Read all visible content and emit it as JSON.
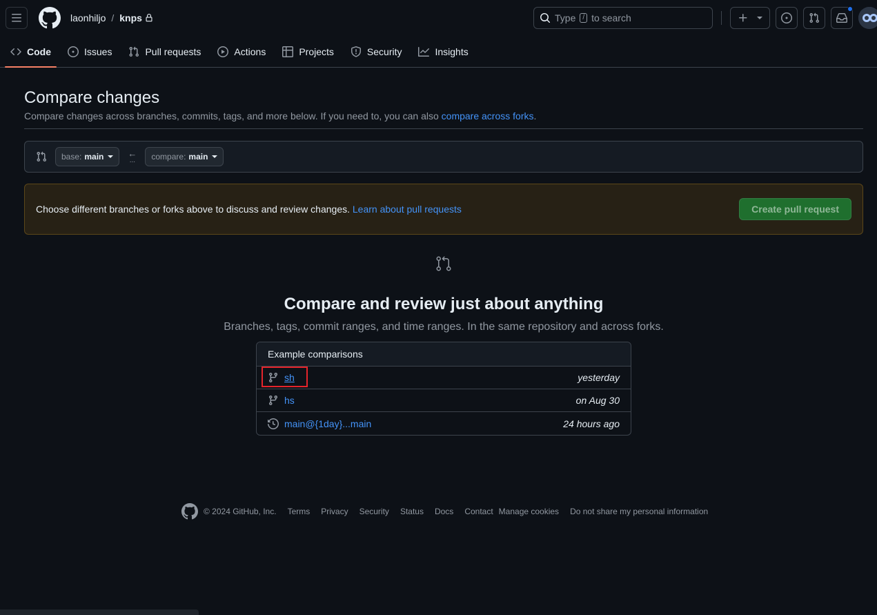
{
  "header": {
    "owner": "laonhiljo",
    "separator": "/",
    "repo": "knps",
    "search_type": "Type",
    "search_key": "/",
    "search_rest": "to search"
  },
  "nav": [
    {
      "label": "Code",
      "icon": "code-icon"
    },
    {
      "label": "Issues",
      "icon": "issue-icon"
    },
    {
      "label": "Pull requests",
      "icon": "pull-request-icon"
    },
    {
      "label": "Actions",
      "icon": "play-icon"
    },
    {
      "label": "Projects",
      "icon": "table-icon"
    },
    {
      "label": "Security",
      "icon": "shield-icon"
    },
    {
      "label": "Insights",
      "icon": "graph-icon"
    }
  ],
  "compare": {
    "title": "Compare changes",
    "subtitle": "Compare changes across branches, commits, tags, and more below. If you need to, you can also",
    "subtitle_link": "compare across forks",
    "subtitle_end": ".",
    "base_prefix": "base:",
    "base_value": "main",
    "compare_prefix": "compare:",
    "compare_value": "main",
    "arrow": "←",
    "dots": "..."
  },
  "flash": {
    "text": "Choose different branches or forks above to discuss and review changes.",
    "link": "Learn about pull requests",
    "button": "Create pull request"
  },
  "blankslate": {
    "title": "Compare and review just about anything",
    "subtitle": "Branches, tags, commit ranges, and time ranges. In the same repository and across forks."
  },
  "examples": {
    "header": "Example comparisons",
    "rows": [
      {
        "name": "sh",
        "time": "yesterday",
        "icon": "git-branch-icon"
      },
      {
        "name": "hs",
        "time": "on Aug 30",
        "icon": "git-branch-icon"
      },
      {
        "name": "main@{1day}...main",
        "time": "24 hours ago",
        "icon": "history-icon"
      }
    ]
  },
  "footer": {
    "copyright": "© 2024 GitHub, Inc.",
    "links": [
      "Terms",
      "Privacy",
      "Security",
      "Status",
      "Docs",
      "Contact",
      "Manage cookies",
      "Do not share my personal information"
    ]
  },
  "colors": {
    "background": "#0d1117",
    "accent": "#4493f8",
    "active_tab_underline": "#f78166",
    "button_green": "#1f6f2e",
    "highlight_red": "#e5242b"
  }
}
